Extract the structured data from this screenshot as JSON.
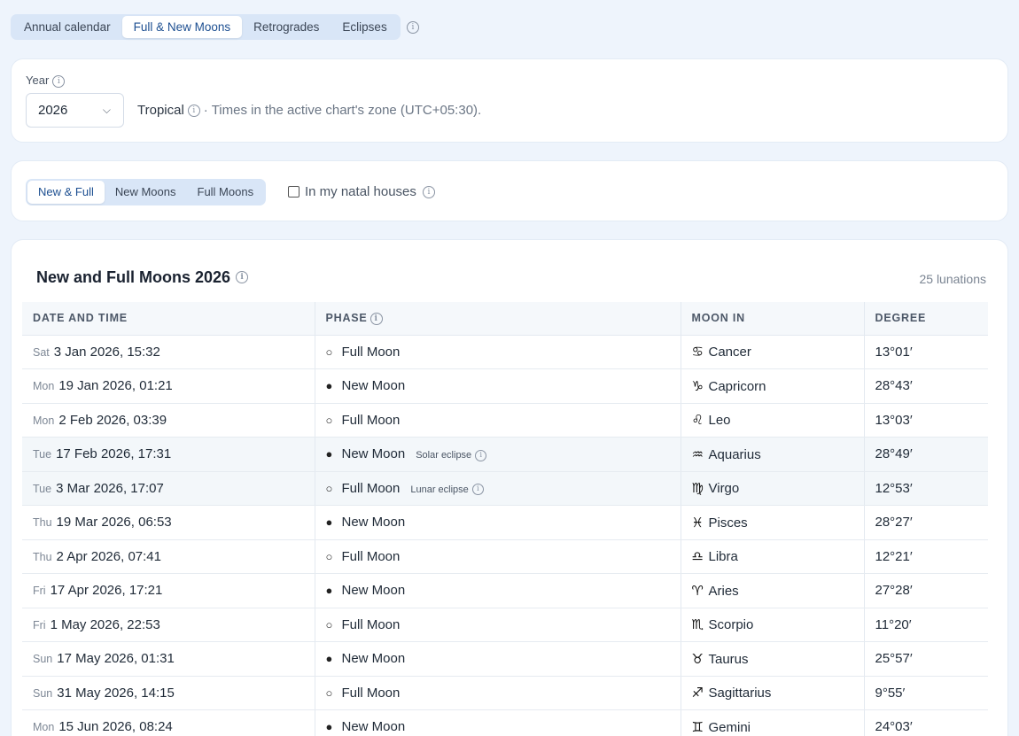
{
  "top_tabs": [
    "Annual calendar",
    "Full & New Moons",
    "Retrogrades",
    "Eclipses"
  ],
  "year_card": {
    "label": "Year",
    "selected_year": "2026",
    "zodiac": "Tropical",
    "timezone_note": "· Times in the active chart's zone (UTC+05:30)."
  },
  "filter_card": {
    "tabs": [
      "New & Full",
      "New Moons",
      "Full Moons"
    ],
    "checkbox_label": "In my natal houses"
  },
  "table_card": {
    "title": "New and Full Moons 2026",
    "count": "25 lunations",
    "headers": [
      "DATE AND TIME",
      "PHASE",
      "MOON IN",
      "DEGREE"
    ],
    "rows": [
      {
        "dow": "Sat",
        "date": "3 Jan 2026, 15:32",
        "phase_glyph": "○",
        "phase": "Full Moon",
        "eclipse": "",
        "sign_glyph": "♋",
        "sign": "Cancer",
        "degree": "13°01′"
      },
      {
        "dow": "Mon",
        "date": "19 Jan 2026, 01:21",
        "phase_glyph": "●",
        "phase": "New Moon",
        "eclipse": "",
        "sign_glyph": "♑",
        "sign": "Capricorn",
        "degree": "28°43′"
      },
      {
        "dow": "Mon",
        "date": "2 Feb 2026, 03:39",
        "phase_glyph": "○",
        "phase": "Full Moon",
        "eclipse": "",
        "sign_glyph": "♌",
        "sign": "Leo",
        "degree": "13°03′"
      },
      {
        "dow": "Tue",
        "date": "17 Feb 2026, 17:31",
        "phase_glyph": "●",
        "phase": "New Moon",
        "eclipse": "Solar eclipse",
        "sign_glyph": "♒",
        "sign": "Aquarius",
        "degree": "28°49′"
      },
      {
        "dow": "Tue",
        "date": "3 Mar 2026, 17:07",
        "phase_glyph": "○",
        "phase": "Full Moon",
        "eclipse": "Lunar eclipse",
        "sign_glyph": "♍",
        "sign": "Virgo",
        "degree": "12°53′"
      },
      {
        "dow": "Thu",
        "date": "19 Mar 2026, 06:53",
        "phase_glyph": "●",
        "phase": "New Moon",
        "eclipse": "",
        "sign_glyph": "♓",
        "sign": "Pisces",
        "degree": "28°27′"
      },
      {
        "dow": "Thu",
        "date": "2 Apr 2026, 07:41",
        "phase_glyph": "○",
        "phase": "Full Moon",
        "eclipse": "",
        "sign_glyph": "♎",
        "sign": "Libra",
        "degree": "12°21′"
      },
      {
        "dow": "Fri",
        "date": "17 Apr 2026, 17:21",
        "phase_glyph": "●",
        "phase": "New Moon",
        "eclipse": "",
        "sign_glyph": "♈",
        "sign": "Aries",
        "degree": "27°28′"
      },
      {
        "dow": "Fri",
        "date": "1 May 2026, 22:53",
        "phase_glyph": "○",
        "phase": "Full Moon",
        "eclipse": "",
        "sign_glyph": "♏",
        "sign": "Scorpio",
        "degree": "11°20′"
      },
      {
        "dow": "Sun",
        "date": "17 May 2026, 01:31",
        "phase_glyph": "●",
        "phase": "New Moon",
        "eclipse": "",
        "sign_glyph": "♉",
        "sign": "Taurus",
        "degree": "25°57′"
      },
      {
        "dow": "Sun",
        "date": "31 May 2026, 14:15",
        "phase_glyph": "○",
        "phase": "Full Moon",
        "eclipse": "",
        "sign_glyph": "♐",
        "sign": "Sagittarius",
        "degree": "9°55′"
      },
      {
        "dow": "Mon",
        "date": "15 Jun 2026, 08:24",
        "phase_glyph": "●",
        "phase": "New Moon",
        "eclipse": "",
        "sign_glyph": "♊",
        "sign": "Gemini",
        "degree": "24°03′"
      }
    ]
  }
}
